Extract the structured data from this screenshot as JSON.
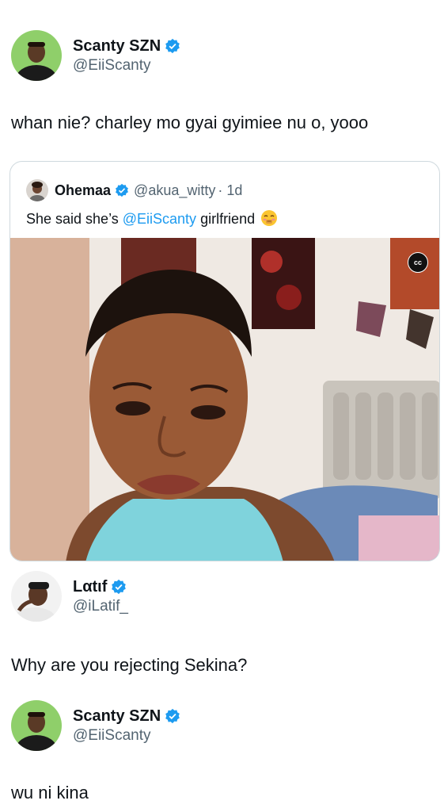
{
  "tweets": [
    {
      "name": "Scanty SZN",
      "handle": "@EiiScanty",
      "text": "whan nie? charley mo gyai gyimiee nu o, yooo"
    },
    {
      "name": "Lαtιf",
      "handle": "@iLatif_",
      "text": "Why are you rejecting Sekina?"
    },
    {
      "name": "Scanty SZN",
      "handle": "@EiiScanty",
      "text": "wu ni kina"
    }
  ],
  "quote": {
    "name": "Ohemaa",
    "handle": "@akua_witty",
    "time": "· 1d",
    "text_before": "She said she’s ",
    "mention": "@EiiScanty",
    "text_after": " girlfriend",
    "emoji": "blushing-emoji",
    "media": {
      "type": "video",
      "cc_label": "cc"
    }
  },
  "colors": {
    "verified_badge": "#1d9bf0",
    "link": "#1d9bf0",
    "secondary_text": "#536471",
    "border": "#cfd9de"
  }
}
